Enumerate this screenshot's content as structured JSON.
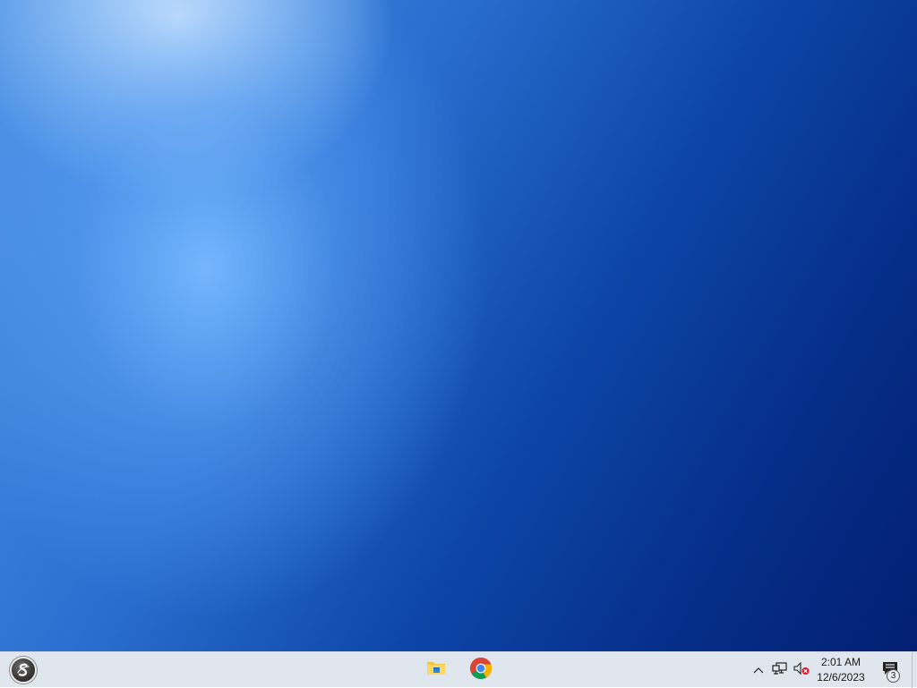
{
  "desktop": {
    "wallpaper": "blue-gradient"
  },
  "taskbar": {
    "start_button": {
      "icon": "logo-icon"
    },
    "pinned_apps": [
      {
        "name": "File Explorer",
        "icon": "folder-icon"
      },
      {
        "name": "Google Chrome",
        "icon": "chrome-icon"
      }
    ],
    "tray": {
      "overflow_icon": "chevron-up-icon",
      "network_icon": "network-icon",
      "volume_icon": "volume-muted-icon",
      "clock": {
        "time": "2:01 AM",
        "date": "12/6/2023"
      },
      "notifications": {
        "icon": "notification-icon",
        "count": "3"
      }
    }
  },
  "colors": {
    "taskbar_bg": "#dfe6ee",
    "desktop_dark": "#031f72",
    "desktop_light": "#78b9ff"
  }
}
